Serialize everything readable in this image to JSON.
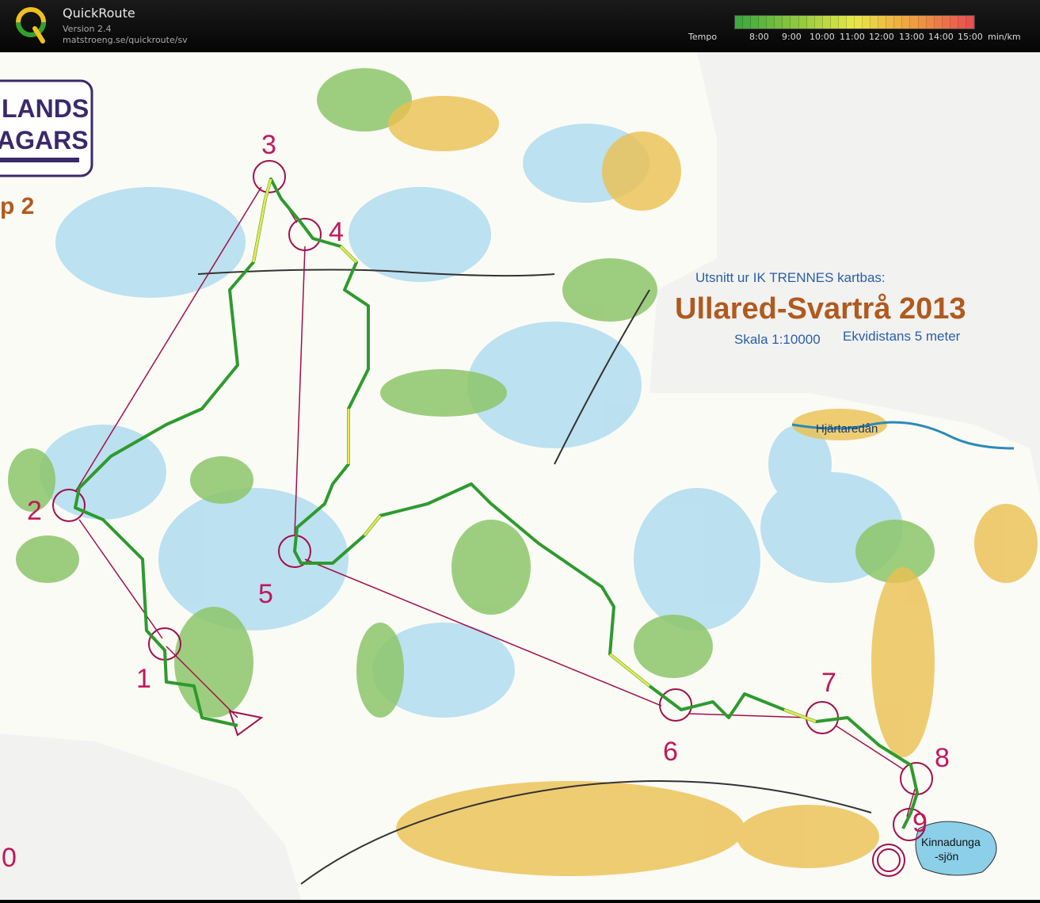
{
  "app": {
    "name": "QuickRoute",
    "version": "Version 2.4",
    "url": "matstroeng.se/quickroute/sv"
  },
  "tempo": {
    "label": "Tempo",
    "ticks": [
      "8:00",
      "9:00",
      "10:00",
      "11:00",
      "12:00",
      "13:00",
      "14:00",
      "15:00"
    ],
    "unit": "min/km",
    "colors": [
      "#3fa83f",
      "#8fc83f",
      "#e8e84a",
      "#f0a040",
      "#e85050"
    ]
  },
  "map": {
    "subtitle": "Utsnitt ur IK TRENNES kartbas:",
    "title": "Ullared-Svartrå 2013",
    "scale": "Skala 1:10000",
    "contour": "Ekvidistans 5 meter",
    "logo_line1": "LANDS",
    "logo_line2": "AGARS",
    "stage": "p 2",
    "river": "Hjärtaredån",
    "lake_line1": "Kinnadunga",
    "lake_line2": "-sjön",
    "controls": [
      "1",
      "2",
      "3",
      "4",
      "5",
      "6",
      "7",
      "8",
      "9",
      "0"
    ],
    "colors": {
      "course": "#a0104a",
      "route": "#2e9a2e",
      "title": "#b05a1e",
      "subtitle": "#2a5fa8",
      "water": "#a8d8ee",
      "forest": "#8cc56a",
      "open": "#e8b840"
    }
  }
}
